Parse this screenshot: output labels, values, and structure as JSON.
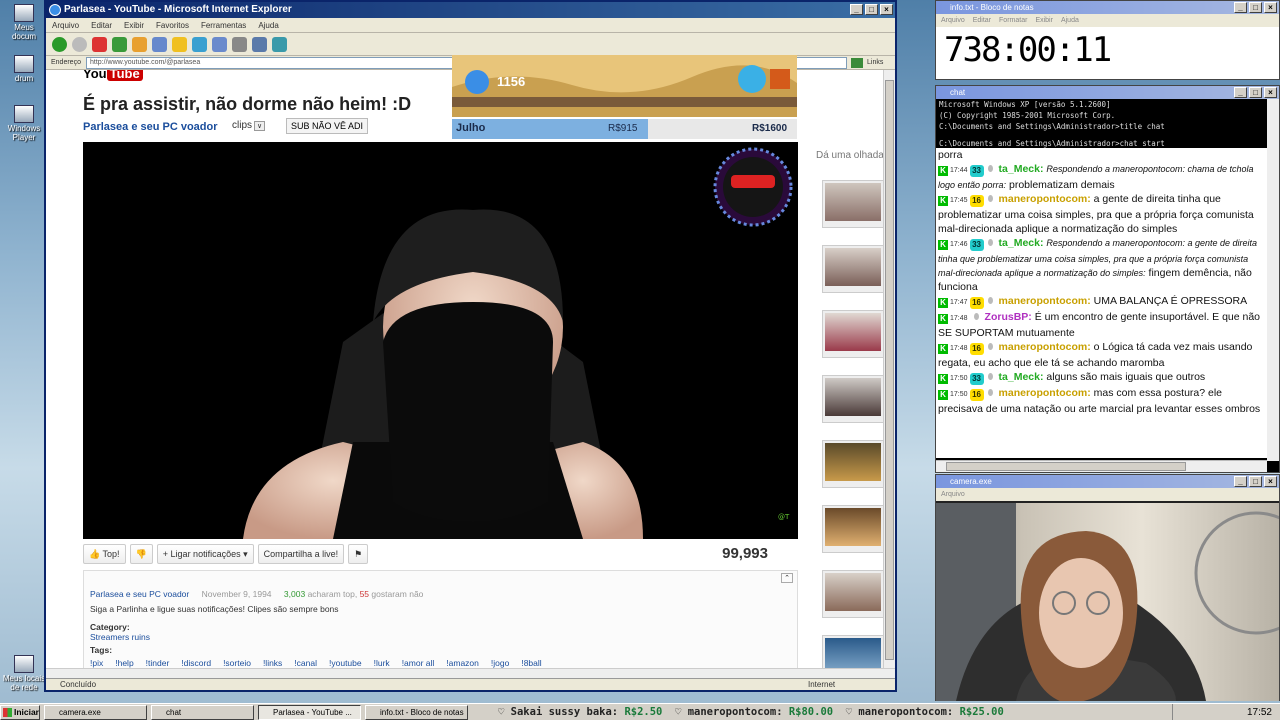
{
  "desktop": {
    "icons": [
      {
        "label": "Meus docum"
      },
      {
        "label": "drum"
      },
      {
        "label": "Windows Player"
      },
      {
        "label": "Meus locais de rede"
      }
    ]
  },
  "ie": {
    "title": "Parlasea - YouTube - Microsoft Internet Explorer",
    "menu": [
      "Arquivo",
      "Editar",
      "Exibir",
      "Favoritos",
      "Ferramentas",
      "Ajuda"
    ],
    "address_label": "Endereço",
    "address_url": "http://www.youtube.com/@parlasea",
    "links_label": "Links",
    "status_text": "Concluído",
    "zone_text": "Internet",
    "page": {
      "logo_you": "You",
      "logo_tube": "Tube",
      "video_title": "É pra assistir, não dorme não heim! :D",
      "channel_name": "Parlasea e seu PC voador",
      "clips_label": "clips",
      "sub_button": "SUB NÃO VÊ ADI",
      "sidebar_label": "Dá uma olhada",
      "actions": {
        "like": "Top!",
        "notify": "Ligar notificações",
        "share": "Compartilha a live!"
      },
      "views": "99,993",
      "desc": {
        "channel": "Parlasea e seu PC voador",
        "date": "November 9, 1994",
        "likes_count": "3,003",
        "likes_text": "acharam top,",
        "dislikes_count": "55",
        "dislikes_text": "gostaram não",
        "text": "Siga a Parlinha e ligue suas notificações! Clipes são sempre bons",
        "category_label": "Category:",
        "category_value": "Streamers ruins",
        "tags_label": "Tags:",
        "tags": [
          "!pix",
          "!help",
          "!tinder",
          "!discord",
          "!sorteio",
          "!links",
          "!canal",
          "!youtube",
          "!lurk",
          "!amor all",
          "!amazon",
          "!jogo",
          "!8ball"
        ]
      },
      "overlay": {
        "month": "Julho",
        "goal1": "R$915",
        "goal2": "R$1600",
        "coins": "1156"
      }
    }
  },
  "notepad": {
    "title": "info.txt - Bloco de notas",
    "menu": [
      "Arquivo",
      "Editar",
      "Formatar",
      "Exibir",
      "Ajuda"
    ],
    "content": "738:00:11"
  },
  "chat_window": {
    "title": "chat",
    "console": [
      "Microsoft Windows XP [versão 5.1.2600]",
      "(C) Copyright 1985-2001 Microsoft Corp.",
      "",
      "C:\\Documents and Settings\\Administrador>title chat",
      "",
      "C:\\Documents and Settings\\Administrador>chat start"
    ],
    "first_line": "porra",
    "messages": [
      {
        "time": "17:44",
        "badge": "33",
        "badge_color": "cyan",
        "user": "ta_Meck:",
        "user_color": "#22aa22",
        "reply": "Respondendo a maneropontocom: chama de tchola logo então porra:",
        "text": "problematizam demais"
      },
      {
        "time": "17:45",
        "badge": "16",
        "badge_color": "yellow",
        "user": "maneropontocom:",
        "user_color": "#c8a000",
        "reply": "",
        "text": "a gente de direita tinha que problematizar uma coisa simples, pra que a própria força comunista mal-direcionada aplique a normatização do simples"
      },
      {
        "time": "17:46",
        "badge": "33",
        "badge_color": "cyan",
        "user": "ta_Meck:",
        "user_color": "#22aa22",
        "reply": "Respondendo a maneropontocom: a gente de direita tinha que problematizar uma coisa simples, pra que a própria força comunista mal-direcionada aplique a normatização do simples:",
        "text": "fingem demência, não funciona"
      },
      {
        "time": "17:47",
        "badge": "16",
        "badge_color": "yellow",
        "user": "maneropontocom:",
        "user_color": "#c8a000",
        "reply": "",
        "text": "UMA BALANÇA É OPRESSORA"
      },
      {
        "time": "17:48",
        "badge": "",
        "badge_color": "",
        "user": "ZorusBP:",
        "user_color": "#b030c0",
        "reply": "",
        "text": "É um encontro de gente insuportável. E que não SE SUPORTAM mutuamente"
      },
      {
        "time": "17:48",
        "badge": "16",
        "badge_color": "yellow",
        "user": "maneropontocom:",
        "user_color": "#c8a000",
        "reply": "",
        "text": "o Lógica tá cada vez mais usando regata, eu acho que ele tá se achando maromba"
      },
      {
        "time": "17:50",
        "badge": "33",
        "badge_color": "cyan",
        "user": "ta_Meck:",
        "user_color": "#22aa22",
        "reply": "",
        "text": "alguns são mais iguais que outros"
      },
      {
        "time": "17:50",
        "badge": "16",
        "badge_color": "yellow",
        "user": "maneropontocom:",
        "user_color": "#c8a000",
        "reply": "",
        "text": "mas com essa postura? ele precisava de uma natação ou arte marcial pra levantar esses ombros"
      }
    ]
  },
  "camera": {
    "title": "camera.exe",
    "menu": "Arquivo"
  },
  "taskbar": {
    "start": "Iniciar",
    "buttons": [
      "camera.exe",
      "chat",
      "Parlasea - YouTube ...",
      "info.txt - Bloco de notas"
    ],
    "ticker": [
      {
        "name": "Sakai sussy baka:",
        "amount": "R$2.50"
      },
      {
        "name": "maneropontocom:",
        "amount": "R$80.00"
      },
      {
        "name": "maneropontocom:",
        "amount": "R$25.00"
      }
    ],
    "clock": "17:52"
  }
}
